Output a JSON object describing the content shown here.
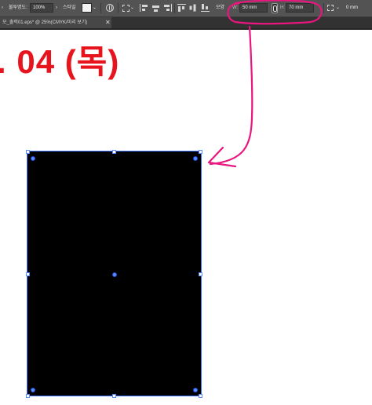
{
  "control_bar": {
    "opacity_label": "불투명도:",
    "opacity_value": "100%",
    "style_label": "스타일",
    "shape_label": "모양",
    "width_prefix": "W:",
    "width_value": "50 mm",
    "height_prefix": "H:",
    "height_value": "70 mm",
    "x_value": "0 mm",
    "chevron": "›",
    "dropdown": "⌄"
  },
  "document_tab": {
    "label": "모_출력01.eps* @ 25%(CMYK/미리 보기)",
    "close": "✕"
  },
  "canvas": {
    "date_text": ". 04 (목)",
    "date_color": "#e8141d",
    "rect_fill": "#000000",
    "selection_color": "#3d74ff"
  },
  "annotation": {
    "color": "#e8167e"
  }
}
